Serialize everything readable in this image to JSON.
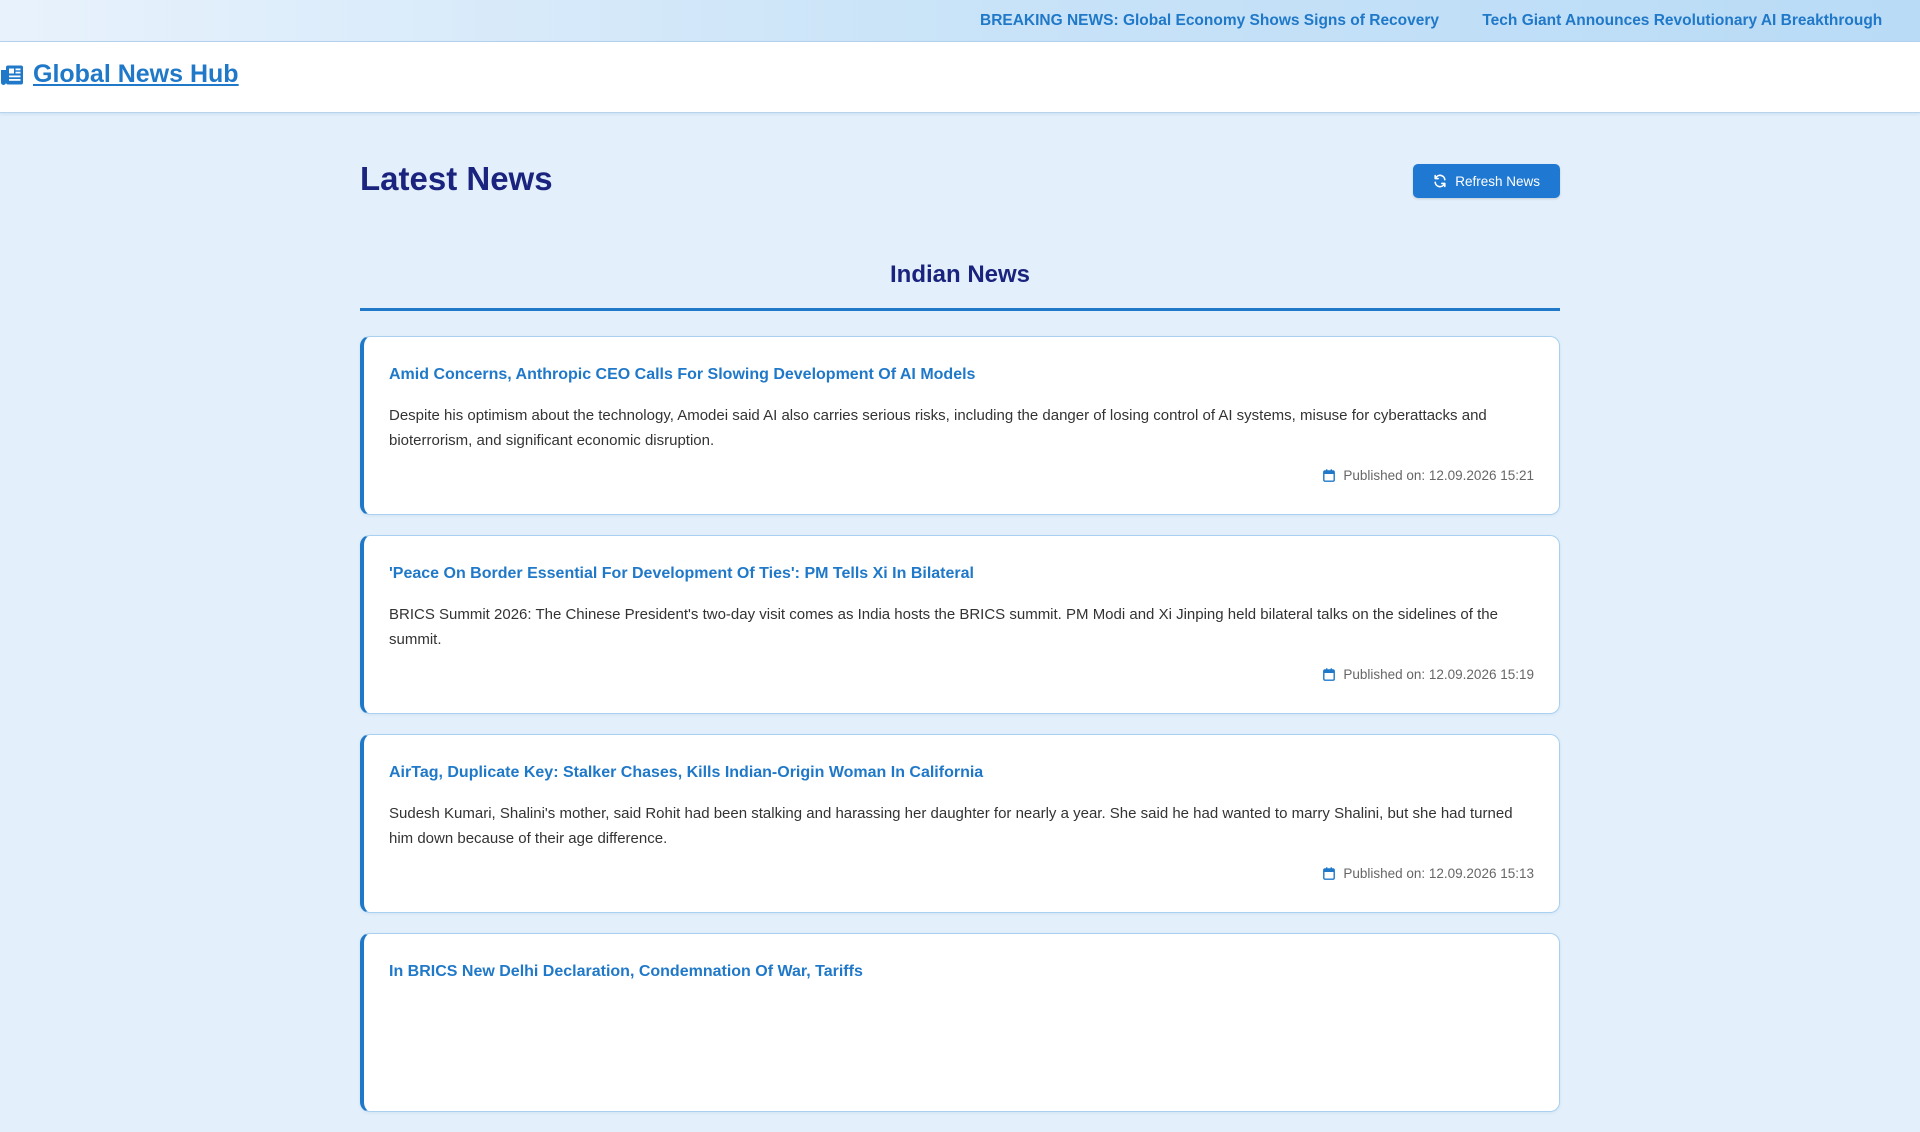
{
  "ticker": {
    "items": [
      "BREAKING NEWS: Global Economy Shows Signs of Recovery",
      "Tech Giant Announces Revolutionary AI Breakthrough"
    ]
  },
  "header": {
    "brand_icon": "newspaper-icon",
    "brand_name": "Global News Hub"
  },
  "main": {
    "title": "Latest News",
    "refresh_icon": "refresh-icon",
    "refresh_label": "Refresh News",
    "section_title": "Indian News",
    "articles": [
      {
        "title": "Amid Concerns, Anthropic CEO Calls For Slowing Development Of AI Models",
        "description": "Despite his optimism about the technology, Amodei said AI also carries serious risks, including the danger of losing control of AI systems, misuse for cyberattacks and bioterrorism, and significant economic disruption.",
        "published": "Published on: 12.09.2026 15:21"
      },
      {
        "title": "'Peace On Border Essential For Development Of Ties': PM Tells Xi In Bilateral",
        "description": "BRICS Summit 2026: The Chinese President's two-day visit comes as India hosts the BRICS summit. PM Modi and Xi Jinping held bilateral talks on the sidelines of the summit.",
        "published": "Published on: 12.09.2026 15:19"
      },
      {
        "title": "AirTag, Duplicate Key: Stalker Chases, Kills Indian-Origin Woman In California",
        "description": "Sudesh Kumari, Shalini's mother, said Rohit had been stalking and harassing her daughter for nearly a year. She said he had wanted to marry Shalini, but she had turned him down because of their age difference.",
        "published": "Published on: 12.09.2026 15:13"
      },
      {
        "title": "In BRICS New Delhi Declaration, Condemnation Of War, Tariffs",
        "description": "",
        "published": ""
      }
    ]
  },
  "colors": {
    "accent": "#1f78c8",
    "heading": "#1a237e",
    "background": "#e3f0fb",
    "button": "#1f78d1"
  }
}
